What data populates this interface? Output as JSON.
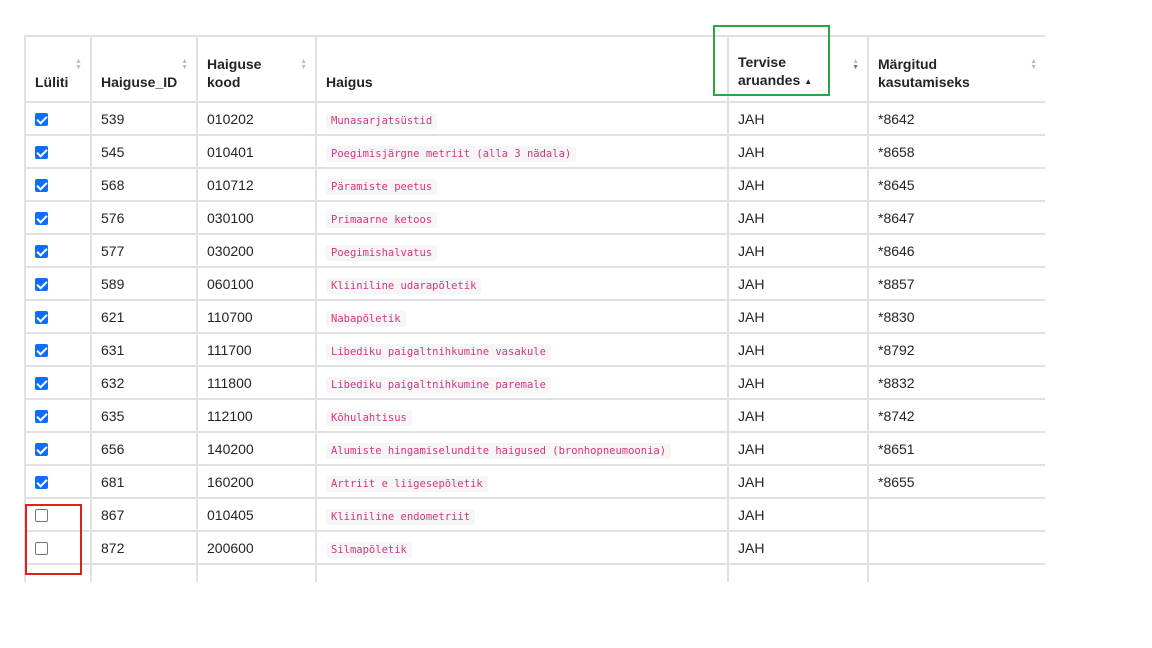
{
  "columns": {
    "toggle": "Lüliti",
    "id": "Haiguse_ID",
    "code": "Haiguse kood",
    "name": "Haigus",
    "report": "Tervise aruandes",
    "marked": "Märgitud kasutamiseks"
  },
  "sort": {
    "column": "Tervise aruandes",
    "direction": "ascending"
  },
  "colors": {
    "checkbox": "#0d6efd",
    "code_text": "#d63384",
    "highlight_green": "#28a745",
    "highlight_red": "#e02020"
  },
  "rows": [
    {
      "checked": true,
      "id": "539",
      "code": "010202",
      "name": "Munasarjatsüstid",
      "report": "JAH",
      "marked": "*8642"
    },
    {
      "checked": true,
      "id": "545",
      "code": "010401",
      "name": "Poegimisjärgne metriit (alla 3 nädala)",
      "report": "JAH",
      "marked": "*8658"
    },
    {
      "checked": true,
      "id": "568",
      "code": "010712",
      "name": "Päramiste peetus",
      "report": "JAH",
      "marked": "*8645"
    },
    {
      "checked": true,
      "id": "576",
      "code": "030100",
      "name": "Primaarne ketoos",
      "report": "JAH",
      "marked": "*8647"
    },
    {
      "checked": true,
      "id": "577",
      "code": "030200",
      "name": "Poegimishalvatus",
      "report": "JAH",
      "marked": "*8646"
    },
    {
      "checked": true,
      "id": "589",
      "code": "060100",
      "name": "Kliiniline udarapõletik",
      "report": "JAH",
      "marked": "*8857"
    },
    {
      "checked": true,
      "id": "621",
      "code": "110700",
      "name": "Nabapõletik",
      "report": "JAH",
      "marked": "*8830"
    },
    {
      "checked": true,
      "id": "631",
      "code": "111700",
      "name": "Libediku paigaltnihkumine vasakule",
      "report": "JAH",
      "marked": "*8792"
    },
    {
      "checked": true,
      "id": "632",
      "code": "111800",
      "name": "Libediku paigaltnihkumine paremale",
      "report": "JAH",
      "marked": "*8832"
    },
    {
      "checked": true,
      "id": "635",
      "code": "112100",
      "name": "Kõhulahtisus",
      "report": "JAH",
      "marked": "*8742"
    },
    {
      "checked": true,
      "id": "656",
      "code": "140200",
      "name": "Alumiste hingamiselundite haigused (bronhopneumoonia)",
      "report": "JAH",
      "marked": "*8651"
    },
    {
      "checked": true,
      "id": "681",
      "code": "160200",
      "name": "Artriit e liigesepõletik",
      "report": "JAH",
      "marked": "*8655"
    },
    {
      "checked": false,
      "id": "867",
      "code": "010405",
      "name": "Kliiniline endometriit",
      "report": "JAH",
      "marked": ""
    },
    {
      "checked": false,
      "id": "872",
      "code": "200600",
      "name": "Silmapõletik",
      "report": "JAH",
      "marked": ""
    },
    {
      "checked": false,
      "id": "",
      "code": "",
      "name": "",
      "report": "",
      "marked": ""
    }
  ]
}
